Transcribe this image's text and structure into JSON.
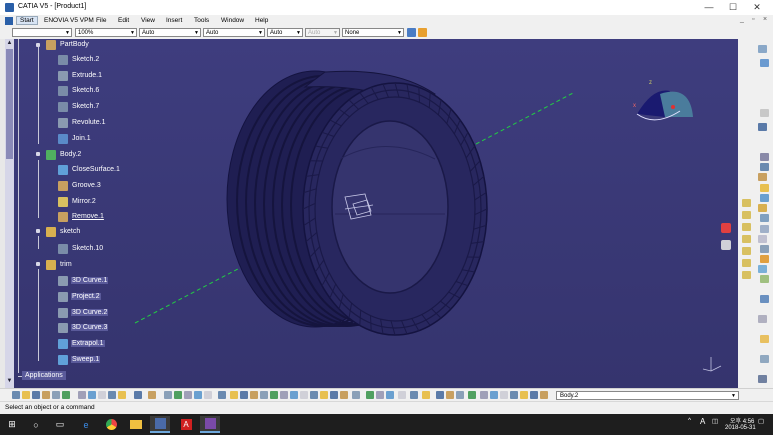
{
  "window": {
    "title": "CATIA V5 - [Product1]",
    "minimize": "—",
    "maximize": "☐",
    "close": "✕"
  },
  "menu": {
    "items": [
      "Start",
      "ENOVIA V5 VPM",
      "File",
      "Edit",
      "View",
      "Insert",
      "Tools",
      "Window",
      "Help"
    ],
    "right_controls": [
      "_",
      "▫",
      "×"
    ]
  },
  "toolbar": {
    "combo_blank": "",
    "zoom": "100%",
    "auto1": "Auto",
    "auto2": "Auto",
    "auto3": "Auto",
    "auto4": "Auto",
    "none": "None"
  },
  "tree": {
    "items": [
      {
        "label": "PartBody",
        "icon": "partbody-icon"
      },
      {
        "label": "Sketch.2",
        "icon": "sketch-icon"
      },
      {
        "label": "Extrude.1",
        "icon": "extrude-icon"
      },
      {
        "label": "Sketch.6",
        "icon": "sketch-icon"
      },
      {
        "label": "Sketch.7",
        "icon": "sketch-icon"
      },
      {
        "label": "Revolute.1",
        "icon": "revolute-icon"
      },
      {
        "label": "Join.1",
        "icon": "join-icon"
      },
      {
        "label": "Body.2",
        "icon": "body-icon"
      },
      {
        "label": "CloseSurface.1",
        "icon": "close-surface-icon"
      },
      {
        "label": "Groove.3",
        "icon": "groove-icon"
      },
      {
        "label": "Mirror.2",
        "icon": "mirror-icon"
      },
      {
        "label": "Remove.1",
        "icon": "remove-icon"
      },
      {
        "label": "sketch",
        "icon": "geometrical-set-icon"
      },
      {
        "label": "Sketch.10",
        "icon": "sketch-icon"
      },
      {
        "label": "trim",
        "icon": "geometrical-set-icon"
      },
      {
        "label": "3D Curve.1",
        "icon": "curve-icon"
      },
      {
        "label": "Project.2",
        "icon": "project-icon"
      },
      {
        "label": "3D Curve.2",
        "icon": "curve-icon"
      },
      {
        "label": "3D Curve.3",
        "icon": "curve-icon"
      },
      {
        "label": "Extrapol.1",
        "icon": "extrapol-icon"
      },
      {
        "label": "Sweep.1",
        "icon": "sweep-icon"
      }
    ],
    "applications": "Applications"
  },
  "bottom": {
    "current_body": "Body.2"
  },
  "status": {
    "message": "Select an object or a command"
  },
  "taskbar": {
    "time": "오후 4:56",
    "date": "2018-05-31",
    "ime": "A",
    "apps": [
      "start-icon",
      "search-icon",
      "task-view-icon",
      "edge-icon",
      "chrome-icon",
      "file-explorer-icon",
      "catia-icon",
      "acrobat-icon",
      "visual-studio-icon"
    ]
  },
  "colors": {
    "viewport": "#3b3a78",
    "model": "#25245c",
    "axis": "#22cc44",
    "selection": "#5a5a9a"
  }
}
